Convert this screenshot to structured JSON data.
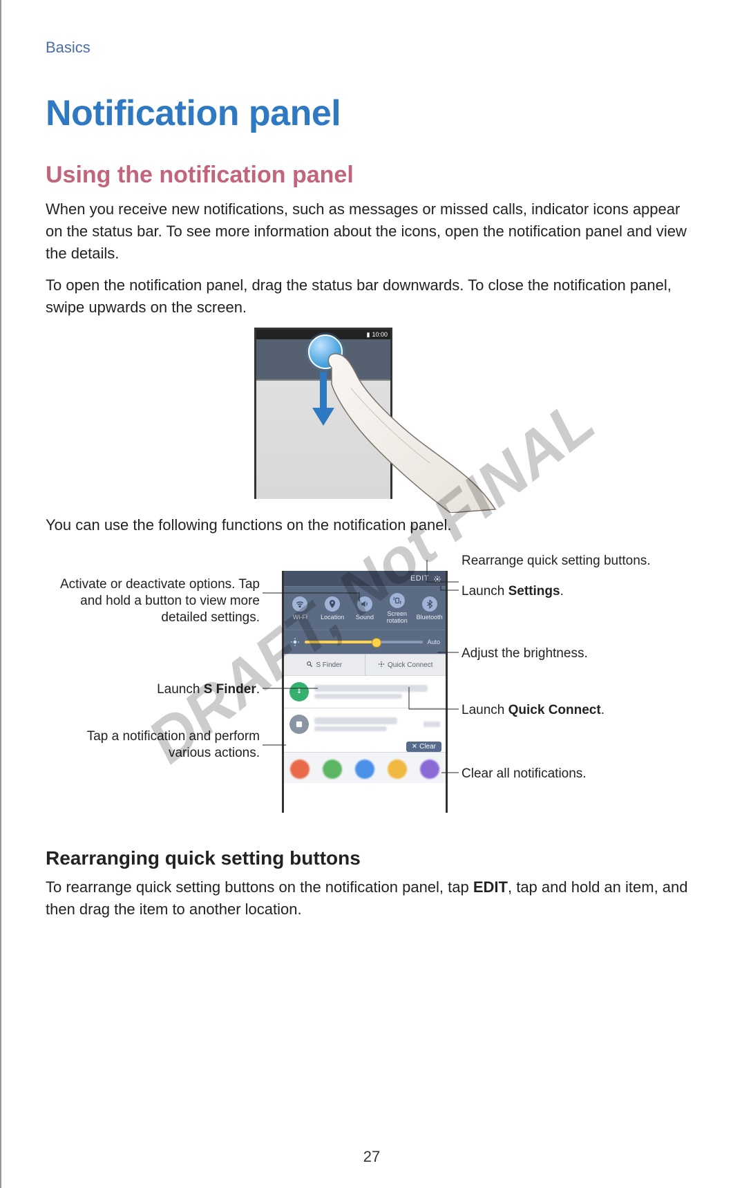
{
  "header": "Basics",
  "title": "Notification panel",
  "subtitle": "Using the notification panel",
  "para1": "When you receive new notifications, such as messages or missed calls, indicator icons appear on the status bar. To see more information about the icons, open the notification panel and view the details.",
  "para2": "To open the notification panel, drag the status bar downwards. To close the notification panel, swipe upwards on the screen.",
  "fig1": {
    "status_time": "10:00"
  },
  "para3": "You can use the following functions on the notification panel.",
  "callouts": {
    "left": {
      "activate": "Activate or deactivate options. Tap and hold a button to view more detailed settings.",
      "sfinder_pre": "Launch ",
      "sfinder_bold": "S Finder",
      "sfinder_post": ".",
      "tap_notification": "Tap a notification and perform various actions."
    },
    "right": {
      "rearrange": "Rearrange quick setting buttons.",
      "settings_pre": "Launch ",
      "settings_bold": "Settings",
      "settings_post": ".",
      "brightness": "Adjust the brightness.",
      "quickconnect_pre": "Launch ",
      "quickconnect_bold": "Quick Connect",
      "quickconnect_post": ".",
      "clear_all": "Clear all notifications."
    }
  },
  "panel": {
    "edit_label": "EDIT",
    "qs_items": [
      "Wi-Fi",
      "Location",
      "Sound",
      "Screen rotation",
      "Bluetooth"
    ],
    "auto_label": "Auto",
    "sfinder_label": "S Finder",
    "quickconnect_label": "Quick Connect",
    "clear_label": "Clear"
  },
  "section_heading": "Rearranging quick setting buttons",
  "para4_pre": "To rearrange quick setting buttons on the notification panel, tap ",
  "para4_bold": "EDIT",
  "para4_post": ", tap and hold an item, and then drag the item to another location.",
  "watermark": "DRAFT, Not FINAL",
  "page_number": "27"
}
